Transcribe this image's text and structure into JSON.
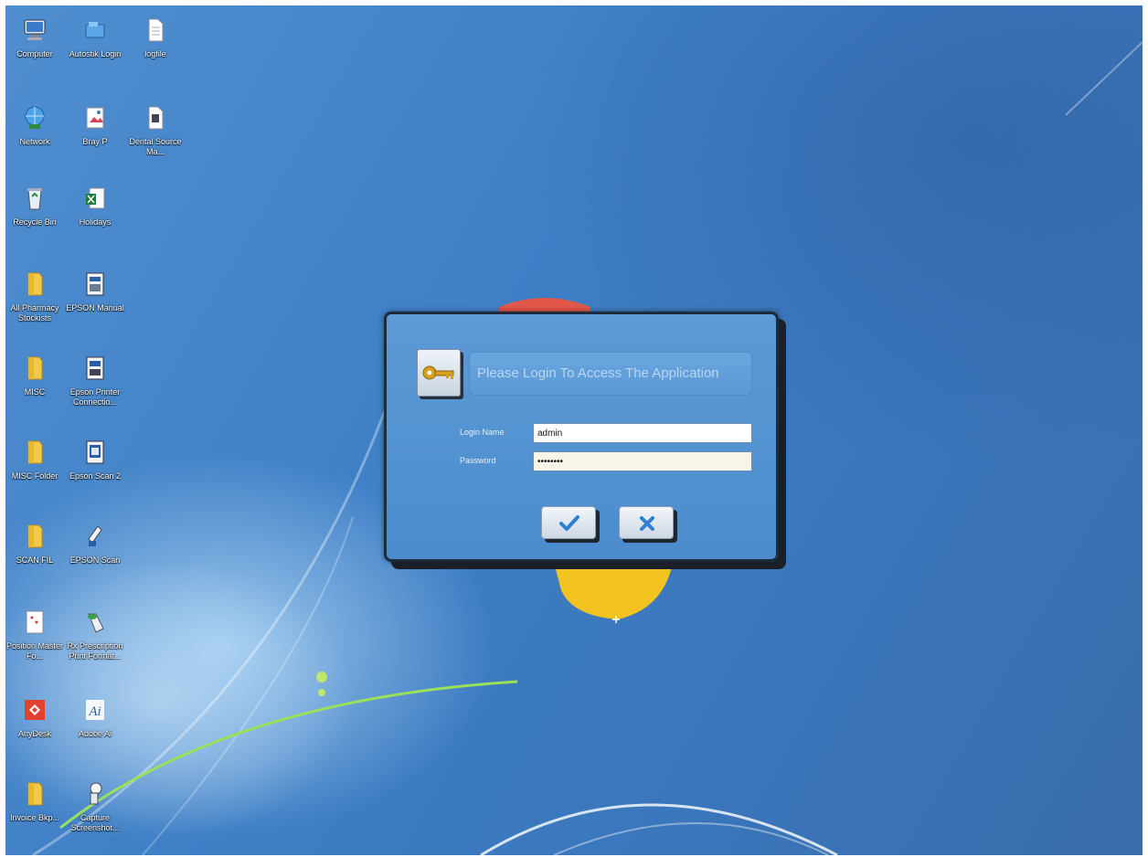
{
  "desktop": {
    "icons": [
      {
        "label": "Computer",
        "icon": "computer-icon"
      },
      {
        "label": "Autostik Login",
        "icon": "network-share-icon"
      },
      {
        "label": "logfile",
        "icon": "text-document-icon"
      },
      {
        "label": "Network",
        "icon": "network-icon"
      },
      {
        "label": "Bray P",
        "icon": "picture-icon"
      },
      {
        "label": "Dental Source Ma...",
        "icon": "document-icon"
      },
      {
        "label": "Recycle Bin",
        "icon": "recycle-bin-icon"
      },
      {
        "label": "Holidays",
        "icon": "excel-icon"
      },
      {
        "label": "All Pharmacy Stockists",
        "icon": "folder-icon"
      },
      {
        "label": "EPSON Manual",
        "icon": "epson-manual-icon"
      },
      {
        "label": "MISC",
        "icon": "folder-icon"
      },
      {
        "label": "Epson Printer Connectio...",
        "icon": "epson-connect-icon"
      },
      {
        "label": "MISC Folder",
        "icon": "folder-icon"
      },
      {
        "label": "Epson Scan 2",
        "icon": "epson-scan-icon"
      },
      {
        "label": "SCAN FIL",
        "icon": "folder-icon"
      },
      {
        "label": "EPSON Scan",
        "icon": "scanner-icon"
      },
      {
        "label": "Position Master Fo...",
        "icon": "sheet-icon"
      },
      {
        "label": "Rx Prescription Print Format...",
        "icon": "pill-icon"
      },
      {
        "label": "AnyDesk",
        "icon": "anydesk-icon"
      },
      {
        "label": "Adobe Ai",
        "icon": "illustrator-icon"
      },
      {
        "label": "Invoice Bkp...",
        "icon": "folder-icon"
      },
      {
        "label": "Capture Screenshot...",
        "icon": "capture-icon"
      }
    ]
  },
  "login": {
    "title": "Please Login To Access The Application",
    "login_name_label": "Login Name",
    "login_name_value": "admin",
    "password_label": "Password",
    "password_value": "••••••••",
    "ok_icon": "check-icon",
    "cancel_icon": "x-icon"
  },
  "colors": {
    "desktop_blue": "#3f7fc6",
    "dialog_blue": "#4c8ccd",
    "check_blue": "#2e7fd1",
    "key_gold": "#d6a21e"
  }
}
